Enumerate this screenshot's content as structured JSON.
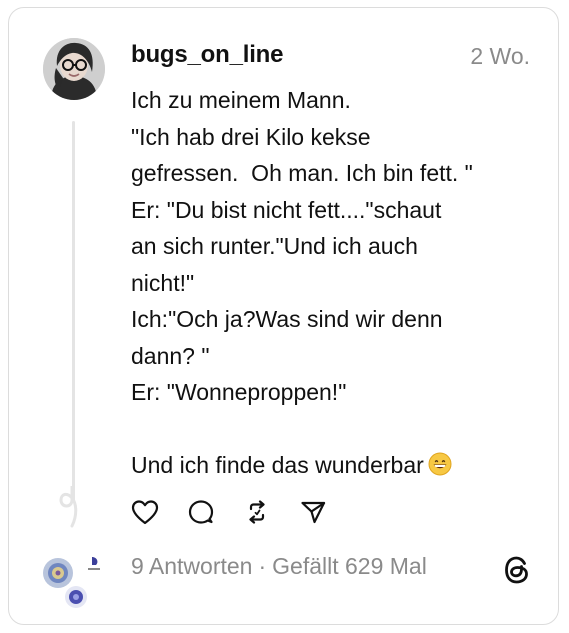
{
  "post": {
    "username": "bugs_on_line",
    "timestamp": "2 Wo.",
    "lines": [
      "Ich zu meinem Mann.",
      "\"Ich hab drei Kilo kekse",
      "gefressen.  Oh man. Ich bin fett. \"",
      "Er: \"Du bist nicht fett....\"schaut",
      "an sich runter.\"Und ich auch",
      "nicht!\"",
      "Ich:\"Och ja?Was sind wir denn",
      "dann? \"",
      "Er: \"Wonneproppen!\"",
      "",
      "Und ich finde das wunderbar"
    ],
    "emoji": "grinning-face-emoji"
  },
  "actions": {
    "icons": [
      "heart-icon",
      "comment-icon",
      "repost-icon",
      "share-icon"
    ]
  },
  "stats": {
    "replies": "9 Antworten",
    "separator": "·",
    "likes": "Gefällt 629 Mal"
  },
  "brand": {
    "logo": "threads-logo-icon"
  },
  "colors": {
    "text": "#111111",
    "muted": "#8a8a8a",
    "border": "#dcdcdc",
    "thread_line": "#e4e4e4"
  }
}
